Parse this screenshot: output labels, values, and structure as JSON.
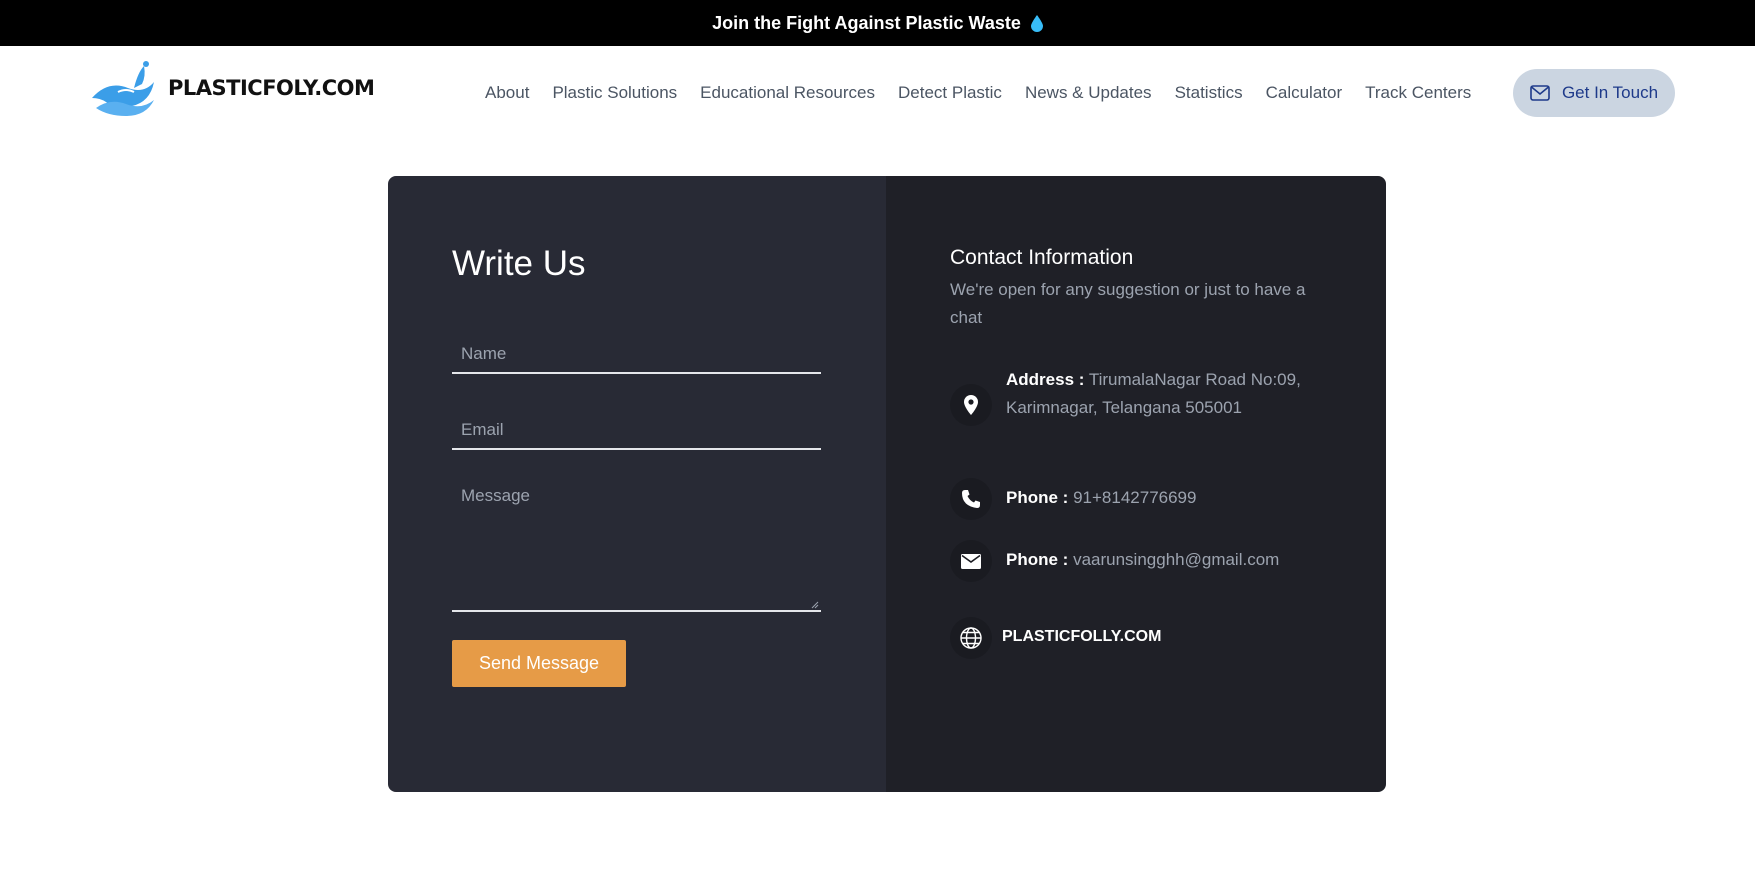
{
  "banner": {
    "text": "Join the Fight Against Plastic Waste"
  },
  "logo": {
    "text": "PLASTICFOLY.COM"
  },
  "nav": {
    "items": [
      {
        "label": "About"
      },
      {
        "label": "Plastic Solutions"
      },
      {
        "label": "Educational Resources"
      },
      {
        "label": "Detect Plastic"
      },
      {
        "label": "News & Updates"
      },
      {
        "label": "Statistics"
      },
      {
        "label": "Calculator"
      },
      {
        "label": "Track Centers"
      }
    ],
    "cta_label": "Get In Touch"
  },
  "form": {
    "title": "Write Us",
    "name_placeholder": "Name",
    "email_placeholder": "Email",
    "message_placeholder": "Message",
    "submit_label": "Send Message"
  },
  "contact": {
    "title": "Contact Information",
    "subtitle": "We're open for any suggestion or just to have a chat",
    "address_label": "Address :",
    "address_value": "TirumalaNagar Road No:09, Karimnagar, Telangana 505001",
    "phone_label": "Phone :",
    "phone_value": "91+8142776699",
    "email_label": "Phone :",
    "email_value": "vaarunsingghh@gmail.com",
    "website": "PLASTICFOLLY.COM"
  },
  "colors": {
    "accent": "#e69b47",
    "cta_bg": "#cbd5e1",
    "left_panel": "#282a35",
    "right_panel": "#1f2027"
  }
}
